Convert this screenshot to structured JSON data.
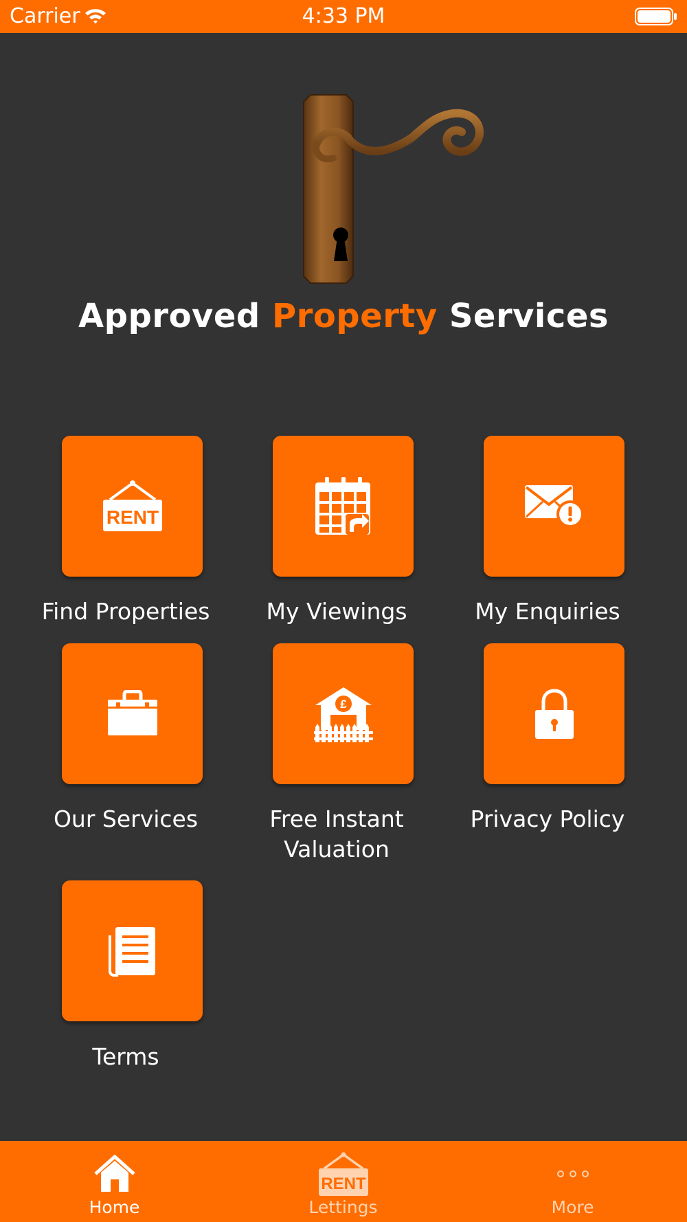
{
  "status_bar": {
    "carrier": "Carrier",
    "time": "4:33 PM"
  },
  "brand": {
    "part1": "Approved",
    "part2": "Property",
    "part3": "Services"
  },
  "colors": {
    "accent": "#FF6D00",
    "background": "#333333",
    "text": "#FFFFFF"
  },
  "tiles": [
    {
      "label": "Find Properties",
      "icon": "rent-sign-icon"
    },
    {
      "label": "My Viewings",
      "icon": "calendar-icon"
    },
    {
      "label": "My Enquiries",
      "icon": "envelope-alert-icon"
    },
    {
      "label": "Our Services",
      "icon": "briefcase-icon"
    },
    {
      "label": "Free Instant\nValuation",
      "icon": "house-pound-icon"
    },
    {
      "label": "Privacy Policy",
      "icon": "lock-icon"
    },
    {
      "label": "Terms",
      "icon": "document-icon"
    }
  ],
  "tab_bar": {
    "items": [
      {
        "label": "Home",
        "icon": "home-icon",
        "active": true
      },
      {
        "label": "Lettings",
        "icon": "rent-sign-icon",
        "active": false
      },
      {
        "label": "More",
        "icon": "more-icon",
        "active": false
      }
    ]
  }
}
